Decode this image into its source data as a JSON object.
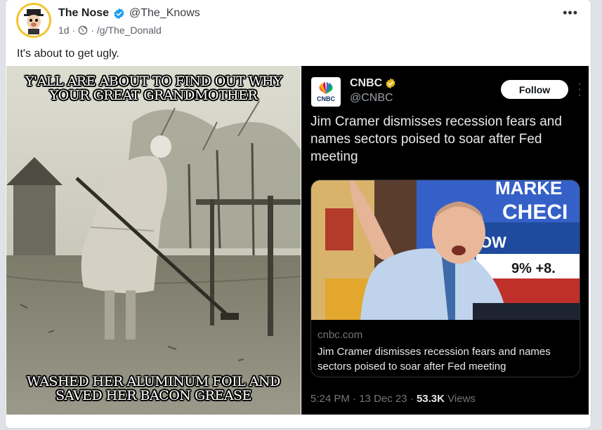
{
  "post": {
    "author": "The Nose",
    "handle": "@The_Knows",
    "age": "1d",
    "separator": "·",
    "group": "/g/The_Donald",
    "text": "It's about to get ugly.",
    "menu_icon": "•••"
  },
  "meme": {
    "top_text": "Y'ALL ARE ABOUT TO FIND OUT WHY YOUR GREAT GRANDMOTHER",
    "bottom_text": "WASHED HER ALUMINUM FOIL AND SAVED HER BACON GREASE"
  },
  "tweet": {
    "name": "CNBC",
    "handle": "@CNBC",
    "follow_label": "Follow",
    "text": "Jim Cramer dismisses recession fears and names sectors poised to soar after Fed meeting",
    "logo_text": "CNBC",
    "link": {
      "domain": "cnbc.com",
      "title": "Jim Cramer dismisses recession fears and names sectors poised to soar after Fed meeting",
      "screen_text_line1": "MARKE",
      "screen_text_line2": "CHECI",
      "ticker_label": "OW",
      "ticker_values": "9%   +8."
    },
    "time": "5:24 PM",
    "date": "13 Dec 23",
    "views_count": "53.3K",
    "views_label": "Views",
    "dot": "·"
  },
  "colors": {
    "avatar_ring": "#f4c430",
    "verified_blue": "#1d9bf0",
    "gold_badge": "#e2b719",
    "tweet_bg": "#000000"
  }
}
